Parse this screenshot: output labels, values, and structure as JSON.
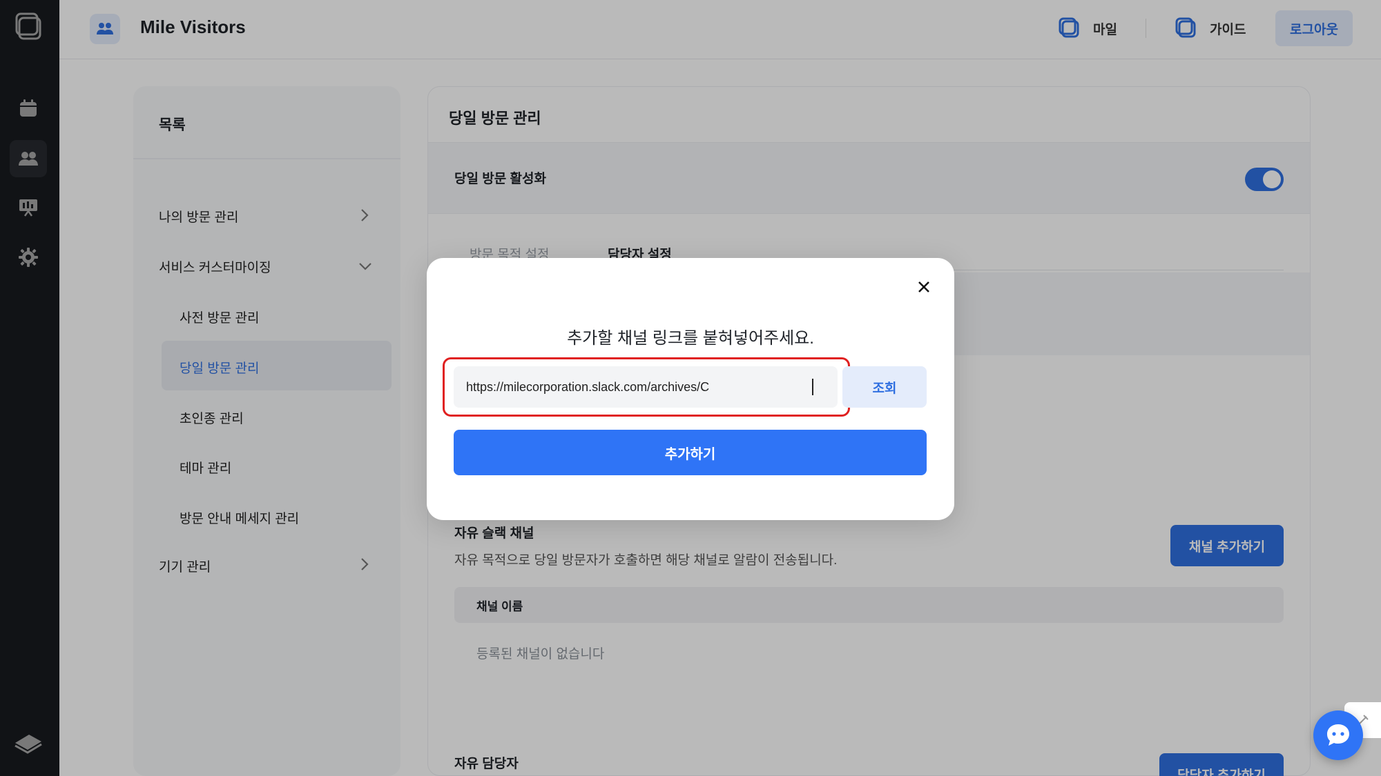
{
  "app": {
    "title": "Mile Visitors"
  },
  "header": {
    "links": [
      {
        "label": "마일",
        "icon": "mile-logo-icon"
      },
      {
        "label": "가이드",
        "icon": "guide-logo-icon"
      }
    ],
    "logout_label": "로그아웃"
  },
  "rail": {
    "items": [
      "calendar-icon",
      "users-icon",
      "presentation-icon",
      "gear-icon"
    ],
    "active_index": 1
  },
  "sidebar": {
    "title": "목록",
    "items": [
      {
        "label": "나의 방문 관리"
      },
      {
        "label": "서비스 커스터마이징"
      },
      {
        "label": "사전 방문 관리"
      },
      {
        "label": "당일 방문 관리"
      },
      {
        "label": "초인종 관리"
      },
      {
        "label": "테마 관리"
      },
      {
        "label": "방문 안내 메세지 관리"
      },
      {
        "label": "기기 관리"
      }
    ],
    "active_item": "당일 방문 관리"
  },
  "content": {
    "title": "당일 방문 관리",
    "activation_label": "당일 방문 활성화",
    "activation_on": true,
    "tabs": [
      {
        "label": "방문 목적 설정"
      },
      {
        "label": "담당자 설정"
      }
    ],
    "free_channel": {
      "title": "자유 슬랙 채널",
      "desc": "자유 목적으로 당일 방문자가 호출하면 해당 채널로 알람이 전송됩니다.",
      "add_button": "채널 추가하기",
      "column": "채널 이름",
      "empty": "등록된 채널이 없습니다"
    },
    "free_manager": {
      "title": "자유 담당자",
      "add_button": "담당자 추가하기"
    }
  },
  "modal": {
    "title": "추가할 채널 링크를 붙혀넣어주세요.",
    "input_value": "https://milecorporation.slack.com/archives/C",
    "lookup_label": "조회",
    "submit_label": "추가하기"
  },
  "colors": {
    "accent": "#2f74f6",
    "highlight": "#e02020",
    "rail": "#262a30"
  }
}
